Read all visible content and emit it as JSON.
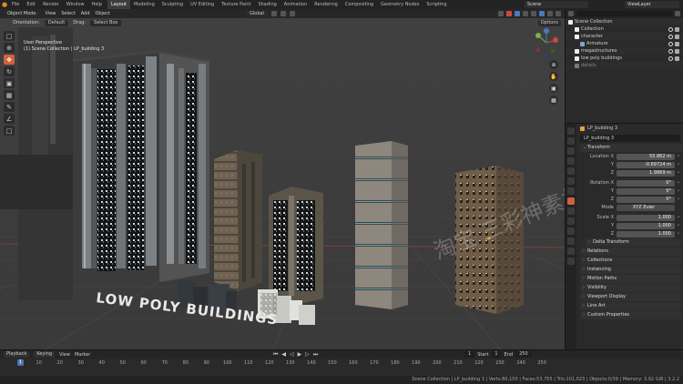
{
  "topbar": {
    "menus": [
      "File",
      "Edit",
      "Render",
      "Window",
      "Help"
    ],
    "workspaces": [
      "Layout",
      "Modeling",
      "Sculpting",
      "UV Editing",
      "Texture Paint",
      "Shading",
      "Animation",
      "Rendering",
      "Compositing",
      "Geometry Nodes",
      "Scripting"
    ],
    "active_workspace": "Layout",
    "scene": "Scene",
    "view_layer": "ViewLayer"
  },
  "viewport": {
    "mode": "Object Mode",
    "menus": [
      "View",
      "Select",
      "Add",
      "Object"
    ],
    "transform_orientation": "Global",
    "orientation_label": "Orientation:",
    "orientation_value": "Default",
    "drag_label": "Drag:",
    "drag_value": "Select Box",
    "options": "Options",
    "info_line1": "User Perspective",
    "info_line2": "(1) Scene Collection | LP_building 3",
    "ground_text": "LOW POLY BUILDINGS",
    "watermark": "淘宝 三彩神素材"
  },
  "outliner": {
    "root": "Scene Collection",
    "items": [
      {
        "name": "Collection",
        "type": "collection"
      },
      {
        "name": "character",
        "type": "collection"
      },
      {
        "name": "Armature",
        "type": "armature"
      },
      {
        "name": "megastructures",
        "type": "collection"
      },
      {
        "name": "low poly buildings",
        "type": "collection"
      },
      {
        "name": "details",
        "type": "collection"
      }
    ]
  },
  "properties": {
    "object_header": "LP_building 3",
    "object_name": "LP_building 3",
    "transform_label": "Transform",
    "location_label": "Location X",
    "location": [
      "55.862 m",
      "-0.69724 m",
      "1.9869 m"
    ],
    "rotation_label": "Rotation X",
    "rotation": [
      "0°",
      "0°",
      "0°"
    ],
    "mode_label": "Mode",
    "mode_value": "XYZ Euler",
    "scale_label": "Scale X",
    "scale": [
      "1.000",
      "1.000",
      "1.000"
    ],
    "axis_labels": [
      "X",
      "Y",
      "Z"
    ],
    "delta_transform": "Delta Transform",
    "sections": [
      "Relations",
      "Collections",
      "Instancing",
      "Motion Paths",
      "Visibility",
      "Viewport Display",
      "Line Art",
      "Custom Properties"
    ]
  },
  "timeline": {
    "menus": [
      "Playback",
      "Keying",
      "View",
      "Marker"
    ],
    "current_frame": "1",
    "start_label": "Start",
    "start": "1",
    "end_label": "End",
    "end": "250",
    "ticks": [
      "1",
      "10",
      "20",
      "30",
      "40",
      "50",
      "60",
      "70",
      "80",
      "90",
      "100",
      "110",
      "120",
      "130",
      "140",
      "150",
      "160",
      "170",
      "180",
      "190",
      "200",
      "210",
      "220",
      "230",
      "240",
      "250"
    ]
  },
  "statusbar": {
    "stats": "Scene Collection | LP_building 3 | Verts:80,150 | Faces:53,755 | Tris:101,023 | Objects:0/39 | Memory: 3.92 GiB | 3.2.2"
  },
  "colors": {
    "accent": "#d1603d",
    "selection_blue": "#4772b3",
    "background": "#3a3a3a"
  }
}
